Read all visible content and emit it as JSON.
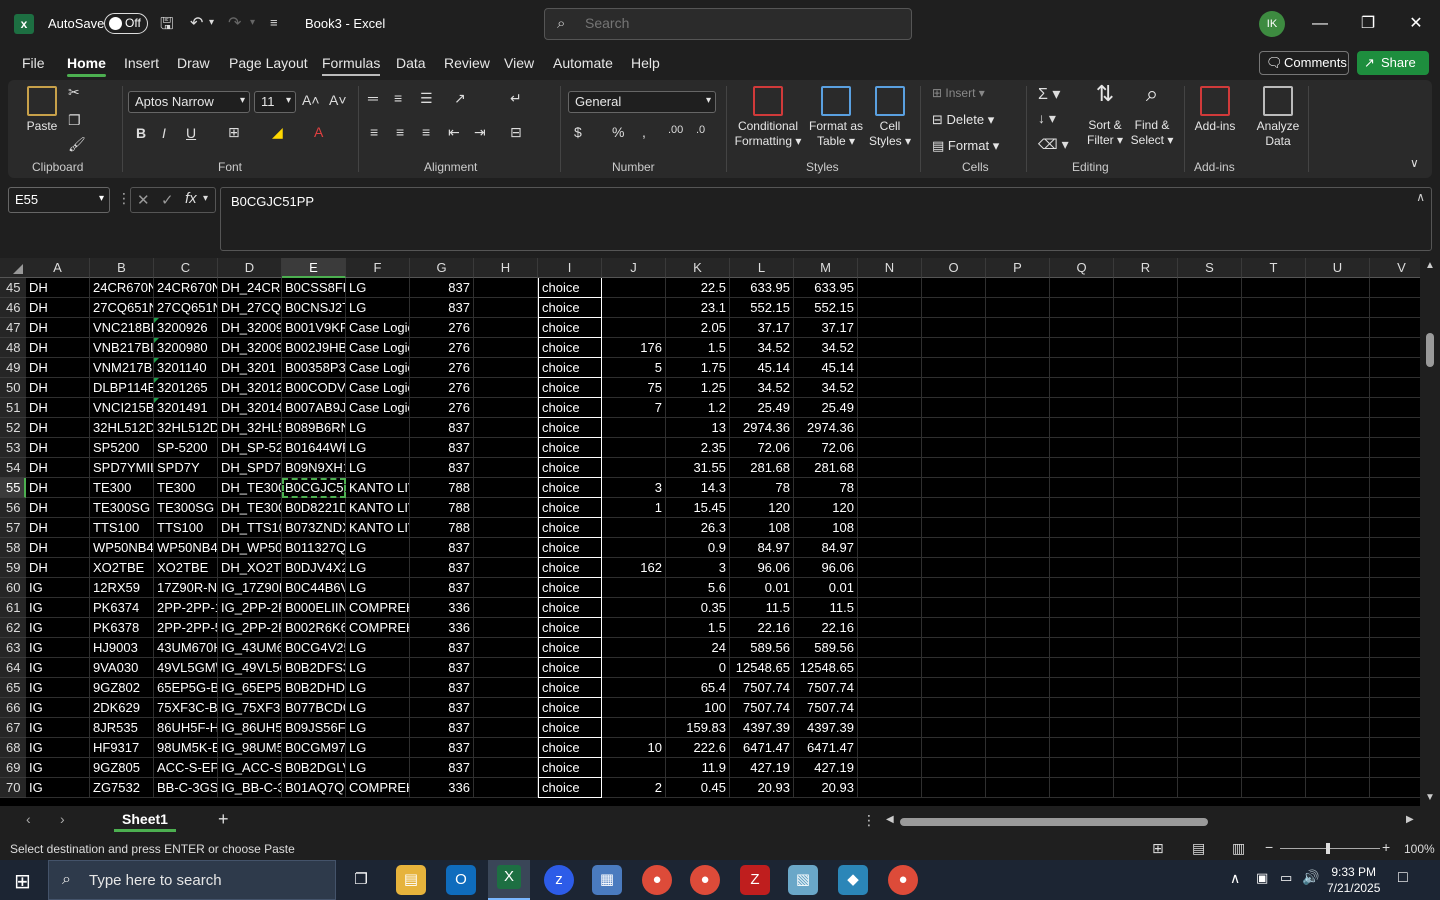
{
  "titlebar": {
    "autosave_label": "AutoSave",
    "autosave_state": "Off",
    "doc_title": "Book3 - Excel",
    "search_placeholder": "Search",
    "avatar_initials": "IK"
  },
  "menu": {
    "tabs": [
      "File",
      "Home",
      "Insert",
      "Draw",
      "Page Layout",
      "Formulas",
      "Data",
      "Review",
      "View",
      "Automate",
      "Help"
    ],
    "active": "Home",
    "comments": "Comments",
    "share": "Share"
  },
  "ribbon": {
    "clipboard": {
      "label": "Clipboard",
      "paste": "Paste"
    },
    "font": {
      "label": "Font",
      "family": "Aptos Narrow",
      "size": "11"
    },
    "alignment": {
      "label": "Alignment"
    },
    "number": {
      "label": "Number",
      "format": "General"
    },
    "styles": {
      "label": "Styles",
      "conditional1": "Conditional",
      "conditional2": "Formatting",
      "format_table1": "Format as",
      "format_table2": "Table",
      "cell_styles1": "Cell",
      "cell_styles2": "Styles"
    },
    "cells": {
      "label": "Cells",
      "insert": "Insert",
      "delete": "Delete",
      "format": "Format"
    },
    "editing": {
      "label": "Editing",
      "sort1": "Sort &",
      "sort2": "Filter",
      "find1": "Find &",
      "find2": "Select"
    },
    "addins": {
      "label": "Add-ins",
      "addins": "Add-ins",
      "analyze1": "Analyze",
      "analyze2": "Data"
    }
  },
  "formula_bar": {
    "name_box": "E55",
    "content": "B0CGJC51PP"
  },
  "columns": [
    "A",
    "B",
    "C",
    "D",
    "E",
    "F",
    "G",
    "H",
    "I",
    "J",
    "K",
    "L",
    "M",
    "N",
    "O",
    "P",
    "Q",
    "R",
    "S",
    "T",
    "U",
    "V"
  ],
  "selected_column": "E",
  "selected_row": "55",
  "rows": [
    {
      "n": "45",
      "A": "DH",
      "B": "24CR670N",
      "C": "24CR670N",
      "D": "DH_24CR6",
      "E": "B0CSS8FM",
      "F": "LG",
      "G": "837",
      "I": "choice",
      "J": "",
      "K": "22.5",
      "L": "633.95",
      "M": "633.95"
    },
    {
      "n": "46",
      "A": "DH",
      "B": "27CQ651N",
      "C": "27CQ651N",
      "D": "DH_27CQ6",
      "E": "B0CNSJ2T!",
      "F": "LG",
      "G": "837",
      "I": "choice",
      "J": "",
      "K": "23.1",
      "L": "552.15",
      "M": "552.15"
    },
    {
      "n": "47",
      "A": "DH",
      "B": "VNC218BL",
      "C": "3200926",
      "D": "DH_32009",
      "E": "B001V9KF.",
      "F": "Case Logic",
      "G": "276",
      "I": "choice",
      "J": "",
      "K": "2.05",
      "L": "37.17",
      "M": "37.17"
    },
    {
      "n": "48",
      "A": "DH",
      "B": "VNB217BL",
      "C": "3200980",
      "D": "DH_32009",
      "E": "B002J9HB!",
      "F": "Case Logic",
      "G": "276",
      "I": "choice",
      "J": "176",
      "K": "1.5",
      "L": "34.52",
      "M": "34.52"
    },
    {
      "n": "49",
      "A": "DH",
      "B": "VNM217BL",
      "C": "3201140",
      "D": "DH_3201",
      "E": "B00358P3Y",
      "F": "Case Logic",
      "G": "276",
      "I": "choice",
      "J": "5",
      "K": "1.75",
      "L": "45.14",
      "M": "45.14"
    },
    {
      "n": "50",
      "A": "DH",
      "B": "DLBP114B",
      "C": "3201265",
      "D": "DH_32012",
      "E": "B00CODV1",
      "F": "Case Logic",
      "G": "276",
      "I": "choice",
      "J": "75",
      "K": "1.25",
      "L": "34.52",
      "M": "34.52"
    },
    {
      "n": "51",
      "A": "DH",
      "B": "VNCI215B",
      "C": "3201491",
      "D": "DH_32014",
      "E": "B007AB9JI",
      "F": "Case Logic",
      "G": "276",
      "I": "choice",
      "J": "7",
      "K": "1.2",
      "L": "25.49",
      "M": "25.49"
    },
    {
      "n": "52",
      "A": "DH",
      "B": "32HL512D",
      "C": "32HL512D-",
      "D": "DH_32HL5",
      "E": "B089B6RN",
      "F": "LG",
      "G": "837",
      "I": "choice",
      "J": "",
      "K": "13",
      "L": "2974.36",
      "M": "2974.36"
    },
    {
      "n": "53",
      "A": "DH",
      "B": "SP5200",
      "C": "SP-5200",
      "D": "DH_SP-52(",
      "E": "B01644WF",
      "F": "LG",
      "G": "837",
      "I": "choice",
      "J": "",
      "K": "2.35",
      "L": "72.06",
      "M": "72.06"
    },
    {
      "n": "54",
      "A": "DH",
      "B": "SPD7YMIL",
      "C": "SPD7Y",
      "D": "DH_SPD7Y",
      "E": "B09N9XH1",
      "F": "LG",
      "G": "837",
      "I": "choice",
      "J": "",
      "K": "31.55",
      "L": "281.68",
      "M": "281.68"
    },
    {
      "n": "55",
      "A": "DH",
      "B": "TE300",
      "C": "TE300",
      "D": "DH_TE300",
      "E": "B0CGJC51",
      "F": "KANTO LIV",
      "G": "788",
      "I": "choice",
      "J": "3",
      "K": "14.3",
      "L": "78",
      "M": "78"
    },
    {
      "n": "56",
      "A": "DH",
      "B": "TE300SG",
      "C": "TE300SG",
      "D": "DH_TE300",
      "E": "B0D8221D",
      "F": "KANTO LIV",
      "G": "788",
      "I": "choice",
      "J": "1",
      "K": "15.45",
      "L": "120",
      "M": "120"
    },
    {
      "n": "57",
      "A": "DH",
      "B": "TTS100",
      "C": "TTS100",
      "D": "DH_TTS10",
      "E": "B073ZNDX",
      "F": "KANTO LIV",
      "G": "788",
      "I": "choice",
      "J": "",
      "K": "26.3",
      "L": "108",
      "M": "108"
    },
    {
      "n": "58",
      "A": "DH",
      "B": "WP50NB4",
      "C": "WP50NB4",
      "D": "DH_WP50I",
      "E": "B011327Q",
      "F": "LG",
      "G": "837",
      "I": "choice",
      "J": "",
      "K": "0.9",
      "L": "84.97",
      "M": "84.97"
    },
    {
      "n": "59",
      "A": "DH",
      "B": "XO2TBE",
      "C": "XO2TBE",
      "D": "DH_XO2TE",
      "E": "B0DJV4X2",
      "F": "LG",
      "G": "837",
      "I": "choice",
      "J": "162",
      "K": "3",
      "L": "96.06",
      "M": "96.06"
    },
    {
      "n": "60",
      "A": "IG",
      "B": "12RX59",
      "C": "17Z90R-N.",
      "D": "IG_17Z90R",
      "E": "B0C44B6V",
      "F": "LG",
      "G": "837",
      "I": "choice",
      "J": "",
      "K": "5.6",
      "L": "0.01",
      "M": "0.01"
    },
    {
      "n": "61",
      "A": "IG",
      "B": "PK6374",
      "C": "2PP-2PP-1",
      "D": "IG_2PP-2P",
      "E": "B000ELIIN",
      "F": "COMPREH",
      "G": "336",
      "I": "choice",
      "J": "",
      "K": "0.35",
      "L": "11.5",
      "M": "11.5"
    },
    {
      "n": "62",
      "A": "IG",
      "B": "PK6378",
      "C": "2PP-2PP-5",
      "D": "IG_2PP-2P",
      "E": "B002R6K6!",
      "F": "COMPREH",
      "G": "336",
      "I": "choice",
      "J": "",
      "K": "1.5",
      "L": "22.16",
      "M": "22.16"
    },
    {
      "n": "63",
      "A": "IG",
      "B": "HJ9003",
      "C": "43UM670H",
      "D": "IG_43UM6",
      "E": "B0CG4V25",
      "F": "LG",
      "G": "837",
      "I": "choice",
      "J": "",
      "K": "24",
      "L": "589.56",
      "M": "589.56"
    },
    {
      "n": "64",
      "A": "IG",
      "B": "9VA030",
      "C": "49VL5GM\\",
      "D": "IG_49VL5G",
      "E": "B0B2DFS3",
      "F": "LG",
      "G": "837",
      "I": "choice",
      "J": "",
      "K": "0",
      "L": "12548.65",
      "M": "12548.65"
    },
    {
      "n": "65",
      "A": "IG",
      "B": "9GZ802",
      "C": "65EP5G-B",
      "D": "IG_65EP5C",
      "E": "B0B2DHD2",
      "F": "LG",
      "G": "837",
      "I": "choice",
      "J": "",
      "K": "65.4",
      "L": "7507.74",
      "M": "7507.74"
    },
    {
      "n": "66",
      "A": "IG",
      "B": "2DK629",
      "C": "75XF3C-B",
      "D": "IG_75XF3C",
      "E": "B077BCDG",
      "F": "LG",
      "G": "837",
      "I": "choice",
      "J": "",
      "K": "100",
      "L": "7507.74",
      "M": "7507.74"
    },
    {
      "n": "67",
      "A": "IG",
      "B": "8JR535",
      "C": "86UH5F-H",
      "D": "IG_86UH5I",
      "E": "B09JS56F4",
      "F": "LG",
      "G": "837",
      "I": "choice",
      "J": "",
      "K": "159.83",
      "L": "4397.39",
      "M": "4397.39"
    },
    {
      "n": "68",
      "A": "IG",
      "B": "HF9317",
      "C": "98UM5K-B",
      "D": "IG_98UM5",
      "E": "B0CGM97\\",
      "F": "LG",
      "G": "837",
      "I": "choice",
      "J": "10",
      "K": "222.6",
      "L": "6471.47",
      "M": "6471.47"
    },
    {
      "n": "69",
      "A": "IG",
      "B": "9GZ805",
      "C": "ACC-S-EP5",
      "D": "IG_ACC-S-",
      "E": "B0B2DGLV",
      "F": "LG",
      "G": "837",
      "I": "choice",
      "J": "",
      "K": "11.9",
      "L": "427.19",
      "M": "427.19"
    },
    {
      "n": "70",
      "A": "IG",
      "B": "ZG7532",
      "C": "BB-C-3GSI",
      "D": "IG_BB-C-3",
      "E": "B01AQ7QI",
      "F": "COMPREH",
      "G": "336",
      "I": "choice",
      "J": "2",
      "K": "0.45",
      "L": "20.93",
      "M": "20.93"
    }
  ],
  "sheet": {
    "name": "Sheet1"
  },
  "status": {
    "message": "Select destination and press ENTER or choose Paste",
    "zoom": "100%"
  },
  "taskbar": {
    "search_placeholder": "Type here to search",
    "time": "9:33 PM",
    "date": "7/21/2025"
  }
}
